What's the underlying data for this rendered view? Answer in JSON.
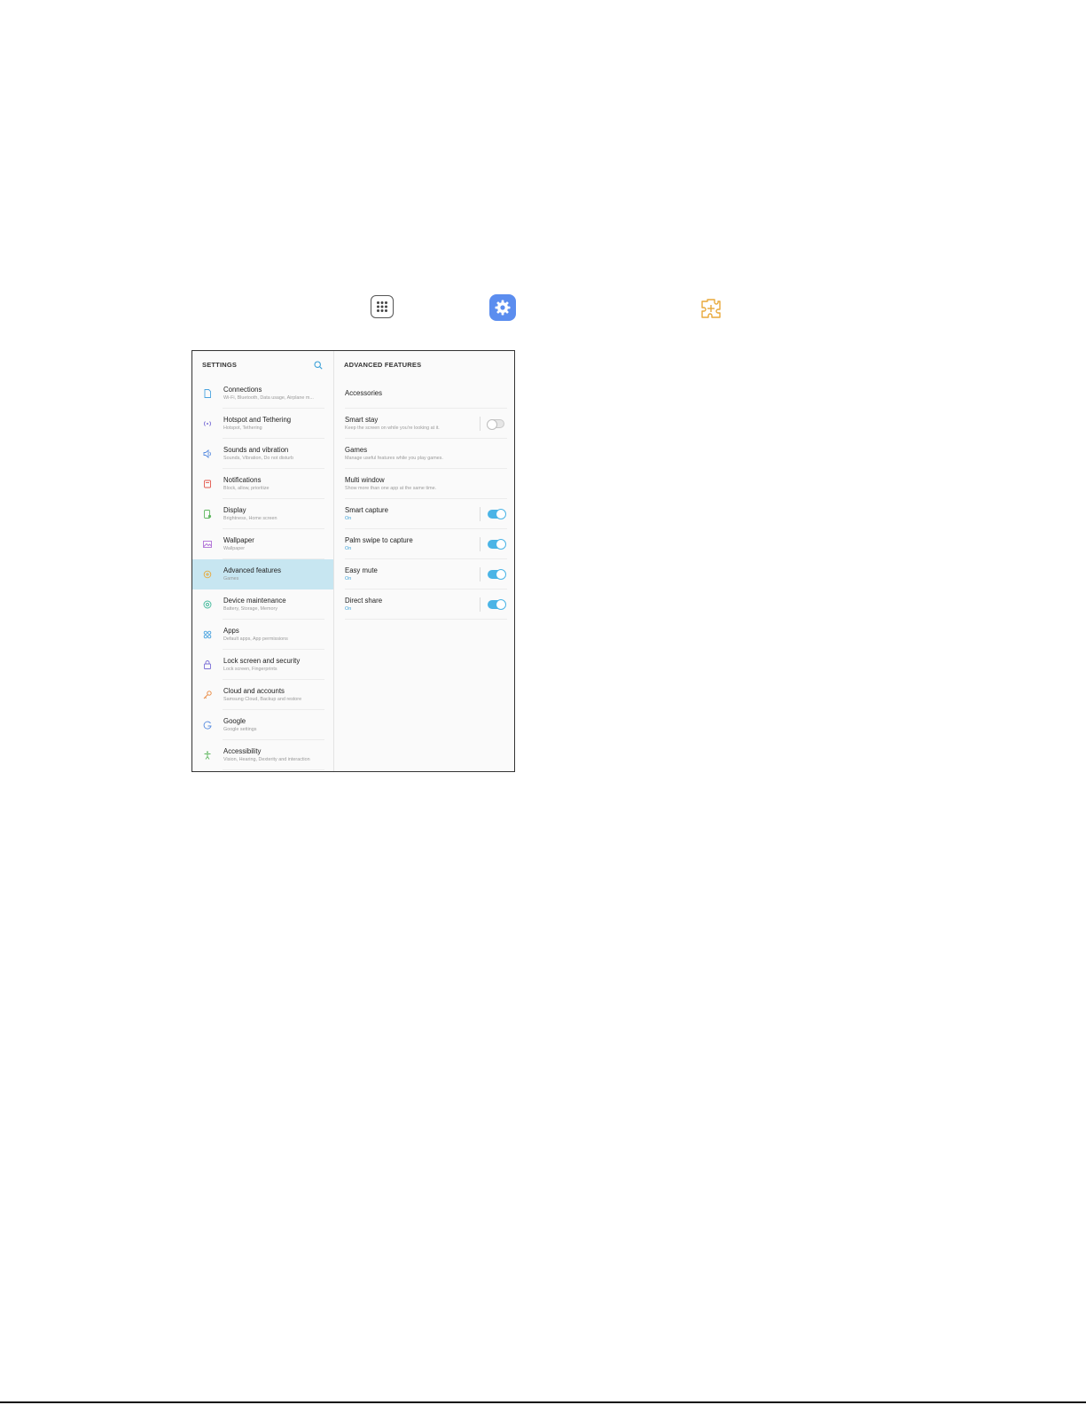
{
  "icons": {
    "apps": "apps-icon",
    "settings": "settings-icon",
    "advanced_features": "advanced-features-icon"
  },
  "settings": {
    "title": "SETTINGS",
    "items": [
      {
        "title": "Connections",
        "subtitle": "Wi-Fi, Bluetooth, Data usage, Airplane m...",
        "icon": "connections-icon",
        "color": "#4aa3df"
      },
      {
        "title": "Hotspot and Tethering",
        "subtitle": "Hotspot, Tethering",
        "icon": "hotspot-icon",
        "color": "#7b6fd6"
      },
      {
        "title": "Sounds and vibration",
        "subtitle": "Sounds, Vibration, Do not disturb",
        "icon": "sound-icon",
        "color": "#5a8de0"
      },
      {
        "title": "Notifications",
        "subtitle": "Block, allow, prioritize",
        "icon": "notifications-icon",
        "color": "#e2574c"
      },
      {
        "title": "Display",
        "subtitle": "Brightness, Home screen",
        "icon": "display-icon",
        "color": "#5fb75f"
      },
      {
        "title": "Wallpaper",
        "subtitle": "Wallpaper",
        "icon": "wallpaper-icon",
        "color": "#b06fd6"
      },
      {
        "title": "Advanced features",
        "subtitle": "Games",
        "icon": "advanced-features-icon",
        "color": "#e8a93a"
      },
      {
        "title": "Device maintenance",
        "subtitle": "Battery, Storage, Memory",
        "icon": "device-maintenance-icon",
        "color": "#3fb89a"
      },
      {
        "title": "Apps",
        "subtitle": "Default apps, App permissions",
        "icon": "apps-grid-icon",
        "color": "#4aa3df"
      },
      {
        "title": "Lock screen and security",
        "subtitle": "Lock screen, Fingerprints",
        "icon": "lock-icon",
        "color": "#7b6fd6"
      },
      {
        "title": "Cloud and accounts",
        "subtitle": "Samsung Cloud, Backup and restore",
        "icon": "key-icon",
        "color": "#e8853a"
      },
      {
        "title": "Google",
        "subtitle": "Google settings",
        "icon": "google-icon",
        "color": "#5a8de0"
      },
      {
        "title": "Accessibility",
        "subtitle": "Vision, Hearing, Dexterity and interaction",
        "icon": "accessibility-icon",
        "color": "#5fb75f"
      }
    ]
  },
  "advanced": {
    "title": "ADVANCED FEATURES",
    "items": [
      {
        "title": "Accessories",
        "subtitle": "",
        "toggle": null
      },
      {
        "title": "Smart stay",
        "subtitle": "Keep the screen on while you're looking at it.",
        "toggle": "off"
      },
      {
        "title": "Games",
        "subtitle": "Manage useful features while you play games.",
        "toggle": null
      },
      {
        "title": "Multi window",
        "subtitle": "Show more than one app at the same time.",
        "toggle": null
      },
      {
        "title": "Smart capture",
        "subtitle": "On",
        "toggle": "on"
      },
      {
        "title": "Palm swipe to capture",
        "subtitle": "On",
        "toggle": "on"
      },
      {
        "title": "Easy mute",
        "subtitle": "On",
        "toggle": "on"
      },
      {
        "title": "Direct share",
        "subtitle": "On",
        "toggle": "on"
      }
    ]
  }
}
